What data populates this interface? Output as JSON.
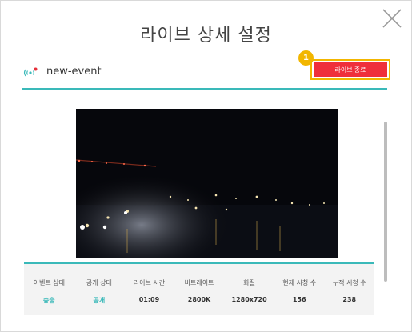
{
  "dialog": {
    "title": "라이브 상세 설정",
    "event_name": "new-event",
    "end_button_label": "라이브 종료",
    "step_badge": "1"
  },
  "colors": {
    "accent_teal": "#3ab9b9",
    "end_button": "#ef2f3b",
    "highlight": "#f2b600"
  },
  "icons": {
    "close": "close-icon",
    "live": "live-broadcast-icon"
  },
  "stats": [
    {
      "label": "이벤트 상태",
      "value": "송출"
    },
    {
      "label": "공개 상태",
      "value": "공개"
    },
    {
      "label": "라이브 시간",
      "value": "01:09"
    },
    {
      "label": "비트레이트",
      "value": "2800K"
    },
    {
      "label": "화질",
      "value": "1280x720"
    },
    {
      "label": "현재 시청 수",
      "value": "156"
    },
    {
      "label": "누적 시청 수",
      "value": "238"
    }
  ]
}
